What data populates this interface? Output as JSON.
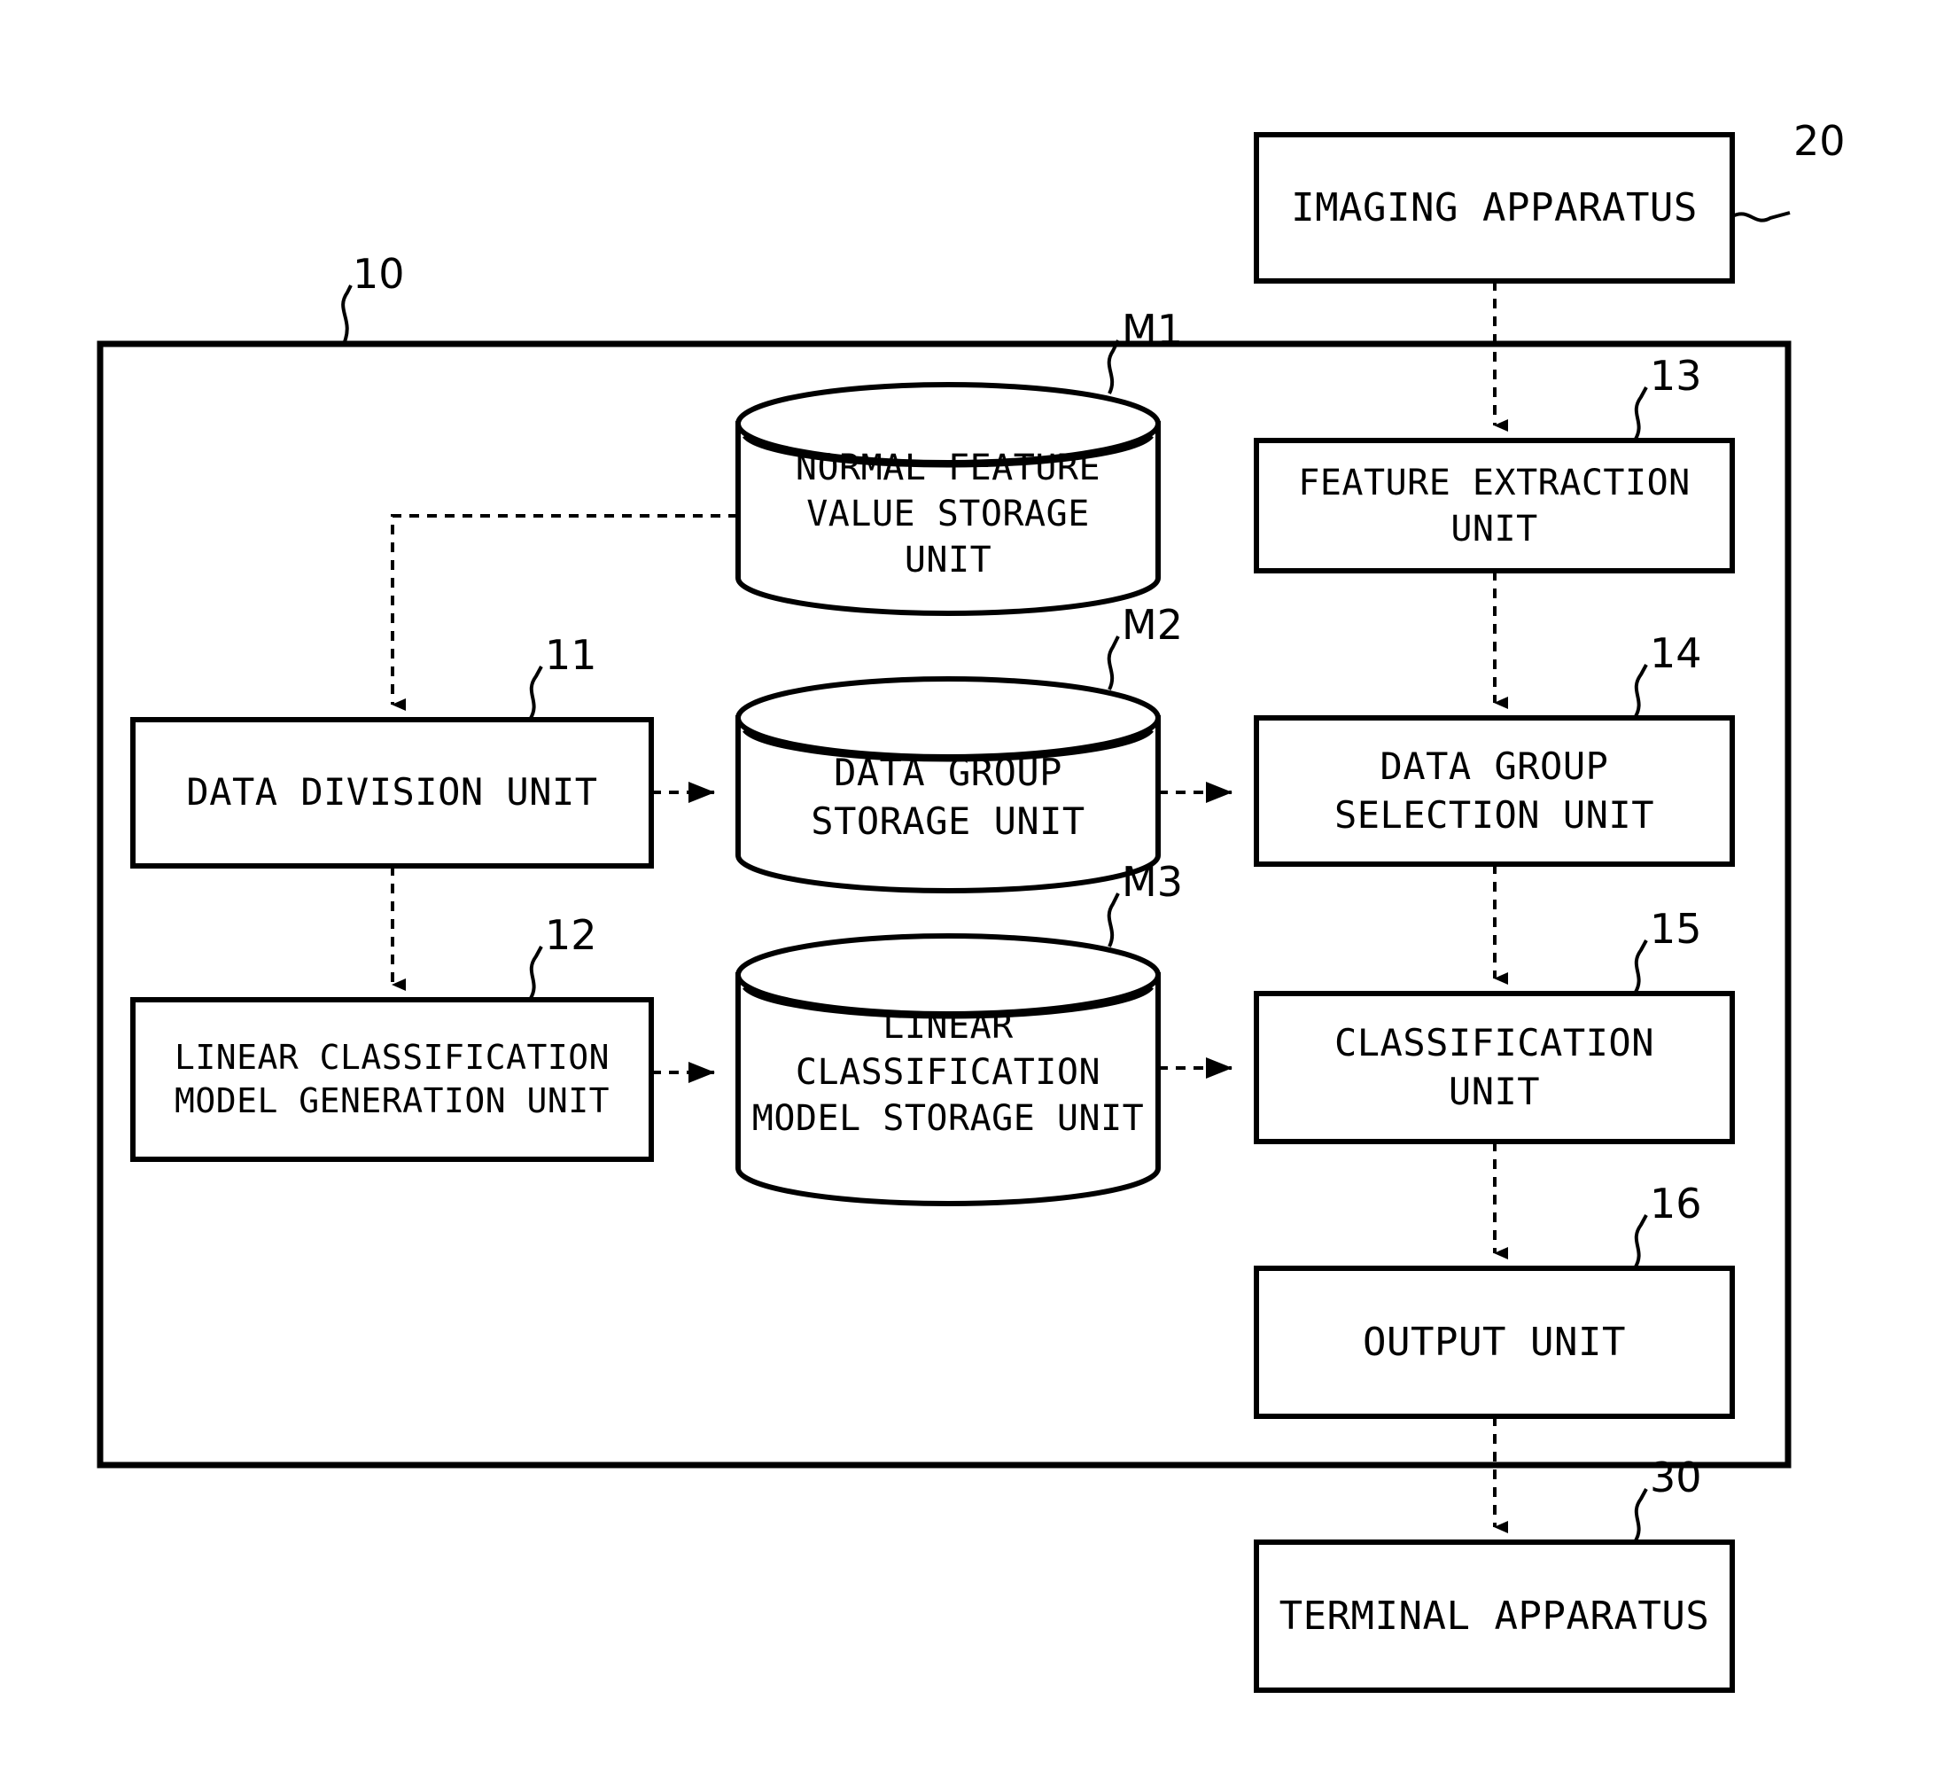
{
  "figure": {
    "type": "patent-block-diagram",
    "background_color": "#ffffff",
    "line_color": "#000000"
  },
  "nodes": {
    "imaging_apparatus": {
      "label": "IMAGING APPARATUS",
      "ref": "20",
      "shape": "rect"
    },
    "outer_system": {
      "ref": "10",
      "shape": "rect-container"
    },
    "normal_feature_storage": {
      "label": "NORMAL FEATURE\nVALUE STORAGE\nUNIT",
      "ref": "M1",
      "shape": "cylinder"
    },
    "feature_extraction": {
      "label": "FEATURE EXTRACTION\nUNIT",
      "ref": "13",
      "shape": "rect"
    },
    "data_division": {
      "label": "DATA DIVISION UNIT",
      "ref": "11",
      "shape": "rect"
    },
    "data_group_storage": {
      "label": "DATA GROUP\nSTORAGE UNIT",
      "ref": "M2",
      "shape": "cylinder"
    },
    "data_group_selection": {
      "label": "DATA GROUP\nSELECTION UNIT",
      "ref": "14",
      "shape": "rect"
    },
    "linear_model_generation": {
      "label": "LINEAR CLASSIFICATION\nMODEL GENERATION UNIT",
      "ref": "12",
      "shape": "rect"
    },
    "linear_model_storage": {
      "label": "LINEAR\nCLASSIFICATION\nMODEL STORAGE UNIT",
      "ref": "M3",
      "shape": "cylinder"
    },
    "classification": {
      "label": "CLASSIFICATION\nUNIT",
      "ref": "15",
      "shape": "rect"
    },
    "output": {
      "label": "OUTPUT UNIT",
      "ref": "16",
      "shape": "rect"
    },
    "terminal_apparatus": {
      "label": "TERMINAL APPARATUS",
      "ref": "30",
      "shape": "rect"
    }
  },
  "connections": [
    {
      "from": "imaging_apparatus",
      "to": "feature_extraction",
      "style": "dashed",
      "arrow": "down"
    },
    {
      "from": "normal_feature_storage",
      "to": "data_division",
      "style": "dashed",
      "arrow": "down"
    },
    {
      "from": "feature_extraction",
      "to": "data_group_selection",
      "style": "dashed",
      "arrow": "down"
    },
    {
      "from": "data_division",
      "to": "data_group_storage",
      "style": "dashed",
      "arrow": "right"
    },
    {
      "from": "data_division",
      "to": "linear_model_generation",
      "style": "dashed",
      "arrow": "down"
    },
    {
      "from": "data_group_storage",
      "to": "data_group_selection",
      "style": "dashed",
      "arrow": "right"
    },
    {
      "from": "linear_model_generation",
      "to": "linear_model_storage",
      "style": "dashed",
      "arrow": "right"
    },
    {
      "from": "linear_model_storage",
      "to": "classification",
      "style": "dashed",
      "arrow": "right"
    },
    {
      "from": "data_group_selection",
      "to": "classification",
      "style": "dashed",
      "arrow": "down"
    },
    {
      "from": "classification",
      "to": "output",
      "style": "dashed",
      "arrow": "down"
    },
    {
      "from": "output",
      "to": "terminal_apparatus",
      "style": "dashed",
      "arrow": "down"
    }
  ]
}
